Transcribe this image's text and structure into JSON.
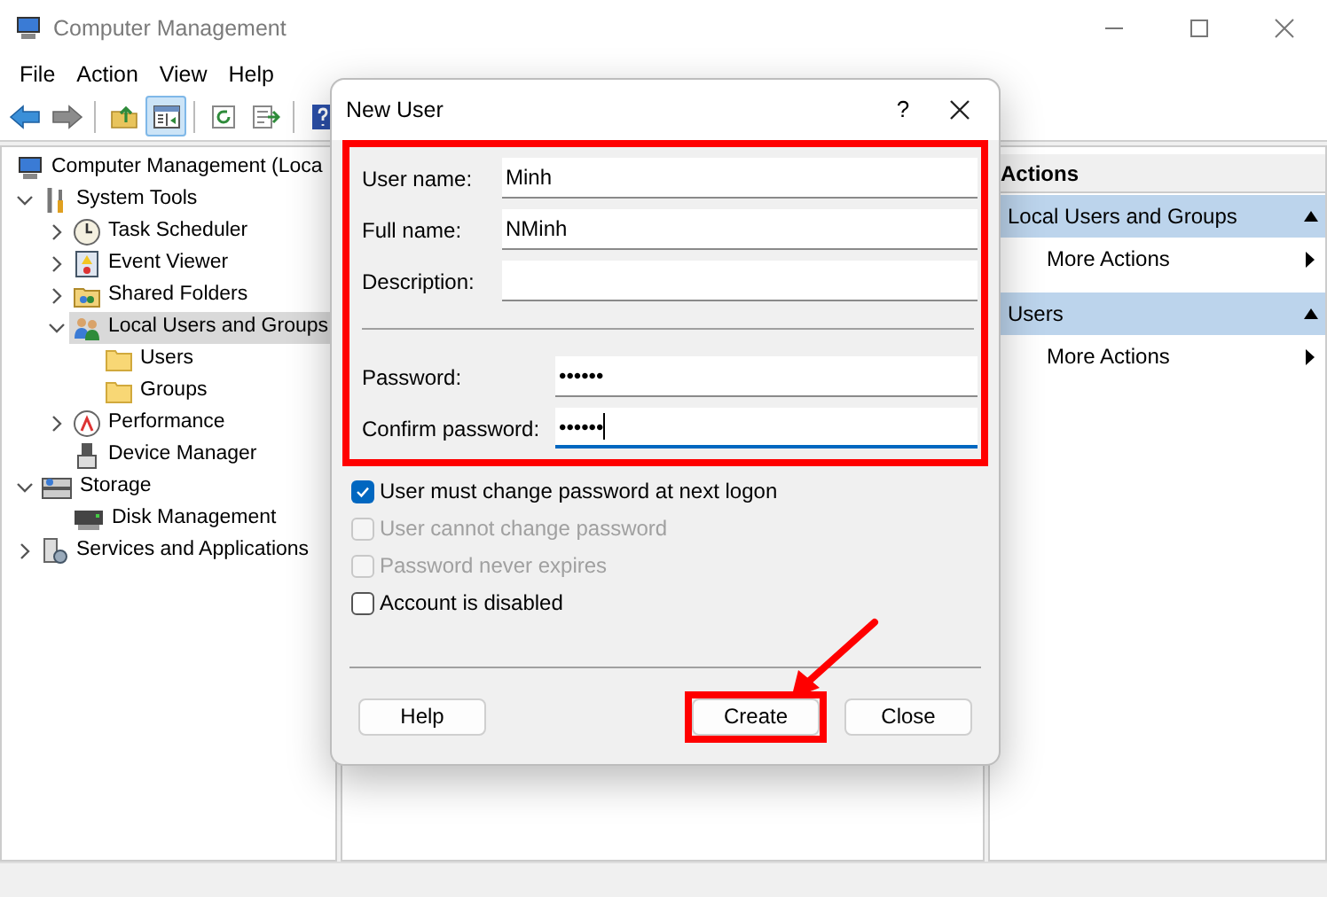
{
  "window": {
    "title": "Computer Management"
  },
  "menu": [
    "File",
    "Action",
    "View",
    "Help"
  ],
  "toolbar": [
    [
      {
        "kind": "back",
        "pressed": false
      },
      {
        "kind": "forward",
        "pressed": false
      }
    ],
    [
      {
        "kind": "up",
        "pressed": false
      },
      {
        "kind": "tree",
        "pressed": true
      }
    ],
    [
      {
        "kind": "refresh",
        "pressed": false
      },
      {
        "kind": "export",
        "pressed": false
      }
    ],
    [
      {
        "kind": "help",
        "pressed": false
      }
    ]
  ],
  "tree": {
    "label": "Computer Management (Loca",
    "kind": "computer",
    "selected": false,
    "children": [
      {
        "label": "System Tools",
        "kind": "tools",
        "expanded": true,
        "selected": false,
        "children": [
          {
            "label": "Task Scheduler",
            "kind": "clock",
            "expanded": false,
            "selected": false
          },
          {
            "label": "Event Viewer",
            "kind": "log",
            "expanded": false,
            "selected": false
          },
          {
            "label": "Shared Folders",
            "kind": "share",
            "expanded": false,
            "selected": false
          },
          {
            "label": "Local Users and Groups",
            "kind": "users",
            "expanded": true,
            "selected": true,
            "children": [
              {
                "label": "Users",
                "kind": "folder",
                "selected": false
              },
              {
                "label": "Groups",
                "kind": "folder",
                "selected": false
              }
            ]
          },
          {
            "label": "Performance",
            "kind": "perf",
            "expanded": false,
            "selected": false
          },
          {
            "label": "Device Manager",
            "kind": "device",
            "selected": false
          }
        ]
      },
      {
        "label": "Storage",
        "kind": "storage",
        "expanded": true,
        "selected": false,
        "children": [
          {
            "label": "Disk Management",
            "kind": "disk",
            "selected": false
          }
        ]
      },
      {
        "label": "Services and Applications",
        "kind": "services",
        "expanded": false,
        "selected": false
      }
    ]
  },
  "actions": {
    "title": "Actions",
    "sections": [
      {
        "title": "Local Users and Groups",
        "expanded": true,
        "items": [
          "More Actions"
        ]
      },
      {
        "title": "Users",
        "expanded": true,
        "items": [
          "More Actions"
        ]
      }
    ]
  },
  "dialog": {
    "title": "New User",
    "help_glyph": "?",
    "fields_highlighted": true,
    "identity_fields": [
      {
        "label": "User name:",
        "value": "Minh",
        "focused": false
      },
      {
        "label": "Full name:",
        "value": "NMinh",
        "focused": false
      },
      {
        "label": "Description:",
        "focused": false
      }
    ],
    "password_fields": [
      {
        "label": "Password:",
        "value": "••••••",
        "focused": false
      },
      {
        "label": "Confirm password:",
        "value": "••••••",
        "focused": true
      }
    ],
    "options": [
      {
        "label": "User must change password at next logon",
        "checked": true,
        "disabled": false
      },
      {
        "label": "User cannot change password",
        "checked": false,
        "disabled": true
      },
      {
        "label": "Password never expires",
        "checked": false,
        "disabled": true
      },
      {
        "label": "Account is disabled",
        "checked": false,
        "disabled": false
      }
    ],
    "buttons": [
      {
        "label": "Help",
        "highlighted": false
      },
      {
        "label": "Create",
        "highlighted": true
      },
      {
        "label": "Close",
        "highlighted": false
      }
    ]
  }
}
